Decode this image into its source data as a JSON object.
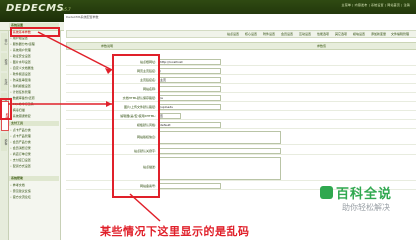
{
  "header": {
    "logo": "DEDECMS",
    "version": "v5.7",
    "links": "主菜单 | 内容发布 | 系统设置 | 网站首页 | 注销"
  },
  "breadcrumb": "DedeCMS系统配置参数",
  "tabs": [
    "站点设置",
    "核心设置",
    "附件设置",
    "会员设置",
    "互动设置",
    "性能选项",
    "其它选项",
    "模块设置",
    "添加新变量",
    "文件编辑管理"
  ],
  "form_header": {
    "left": "参数说明",
    "right": "参数值"
  },
  "rows": [
    {
      "label": "站点根网址:",
      "value": "http://localhost"
    },
    {
      "label": "网页主页链接:",
      "value": "/"
    },
    {
      "label": "主页链接名:",
      "value": "主页"
    },
    {
      "label": "网站名称:",
      "value": ""
    },
    {
      "label": "文档HTML默认保存路径:",
      "value": "/a"
    },
    {
      "label": "图片/上传文件默认路径:",
      "value": "/uploads"
    },
    {
      "label": "编辑器(是/否)使用XHTML:",
      "value": "否"
    },
    {
      "label": "模板默认风格:",
      "value": "default"
    },
    {
      "label": "网站版权信息:",
      "value": ""
    },
    {
      "label": "站点默认关键字:",
      "value": ""
    },
    {
      "label": "站点描述:",
      "value": ""
    },
    {
      "label": "网站备案号:",
      "value": ""
    }
  ],
  "sidebar": {
    "groups": [
      {
        "title": "系统设置",
        "items": [
          "系统基本参数",
          "用户组设置",
          "服务器分布/远程",
          "系统用户管理",
          "验证安全设置",
          "图片水印设置",
          "自定义文档属性",
          "软件频道设置",
          "防采集串混淆",
          "随机模板设置",
          "计划任务管理",
          "数据库备份/还原",
          "SQL命令行工具",
          "病毒扫描",
          "系统错误修复"
        ]
      },
      {
        "title": "支付工具",
        "items": [
          "点卡产品分类",
          "点卡产品管理",
          "会员产品分类",
          "会员消费记录",
          "商店订单记录",
          "支付接口设置",
          "配货方式设置"
        ]
      },
      {
        "title": "系统帮助",
        "items": [
          "参考文档",
          "意见建议反馈",
          "官方交流论坛"
        ]
      }
    ],
    "vtabs": [
      "核心",
      "模块",
      "生成",
      "采集",
      "会员",
      "模板",
      "系统"
    ]
  },
  "caption": "某些情况下这里显示的是乱码",
  "watermark": {
    "title": "百科全说",
    "subtitle": "助你轻松解决"
  },
  "colors": {
    "accent": "#e0202a",
    "brand": "#2f4a12",
    "watermark": "#2fa84f"
  }
}
